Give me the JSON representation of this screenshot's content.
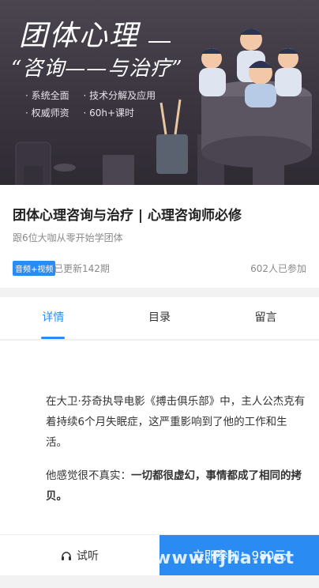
{
  "banner": {
    "title": "团体心理",
    "subtitle": "“咨询——与治疗”",
    "bullets_row1": [
      "· 系统全面",
      "· 技术分解及应用"
    ],
    "bullets_row2": [
      "· 权威师资",
      "· 60h+课时"
    ]
  },
  "course": {
    "title": "团体心理咨询与治疗 | 心理咨询师必修",
    "subtitle": "跟6位大咖从零开始学团体",
    "media_badge": "音频+视频",
    "updated": "已更新142期",
    "joined": "602人已参加"
  },
  "tabs": [
    {
      "label": "详情",
      "active": true
    },
    {
      "label": "目录",
      "active": false
    },
    {
      "label": "留言",
      "active": false
    }
  ],
  "content": {
    "para1": "在大卫·芬奇执导电影《搏击俱乐部》中，主人公杰克有着持续6个月失眠症，这严重影响到了他的工作和生活。",
    "para2_normal": "他感觉很不真实：",
    "para2_bold": "一切都很虚幻，事情都成了相同的拷贝。"
  },
  "bottom": {
    "trial_label": "试听",
    "join_label": "立即参加：980元"
  },
  "watermark": "www.fjha.net",
  "colors": {
    "accent": "#2a8cf2"
  }
}
